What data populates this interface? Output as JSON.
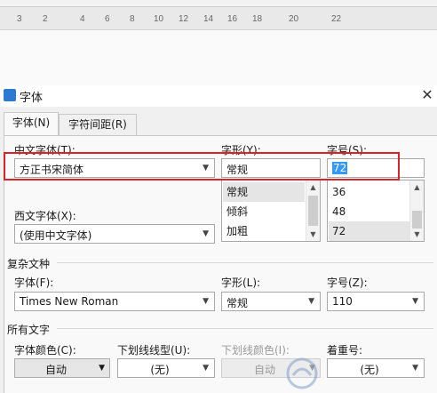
{
  "ruler": {
    "ticks": [
      "3",
      "2",
      "4",
      "6",
      "8",
      "10",
      "12",
      "14",
      "16",
      "18",
      "20",
      "22"
    ]
  },
  "dialog": {
    "title": "字体",
    "close_label": "✕",
    "tabs": [
      {
        "label": "字体(N)",
        "active": true
      },
      {
        "label": "字符间距(R)",
        "active": false
      }
    ],
    "chinese_font": {
      "label": "中文字体(T):",
      "value": "方正书宋简体"
    },
    "style": {
      "label": "字形(Y):",
      "value": "常规",
      "options": [
        "常规",
        "倾斜",
        "加粗"
      ]
    },
    "size": {
      "label": "字号(S):",
      "value": "72",
      "options": [
        "36",
        "48",
        "72"
      ]
    },
    "western_font": {
      "label": "西文字体(X):",
      "value": "(使用中文字体)"
    },
    "complex": {
      "section": "复杂文种",
      "font_label": "字体(F):",
      "font_value": "Times New Roman",
      "style_label": "字形(L):",
      "style_value": "常规",
      "size_label": "字号(Z):",
      "size_value": "110"
    },
    "all_text": {
      "section": "所有文字",
      "color_label": "字体颜色(C):",
      "color_value": "自动",
      "underline_label": "下划线线型(U):",
      "underline_value": "(无)",
      "underline_color_label": "下划线颜色(I):",
      "underline_color_value": "自动",
      "emphasis_label": "着重号:",
      "emphasis_value": "(无)"
    }
  },
  "watermark": "系统之家",
  "colors": {
    "highlight": "#3399ff",
    "red_outline": "#d8232a",
    "list_selected": "#e5e5e5"
  }
}
